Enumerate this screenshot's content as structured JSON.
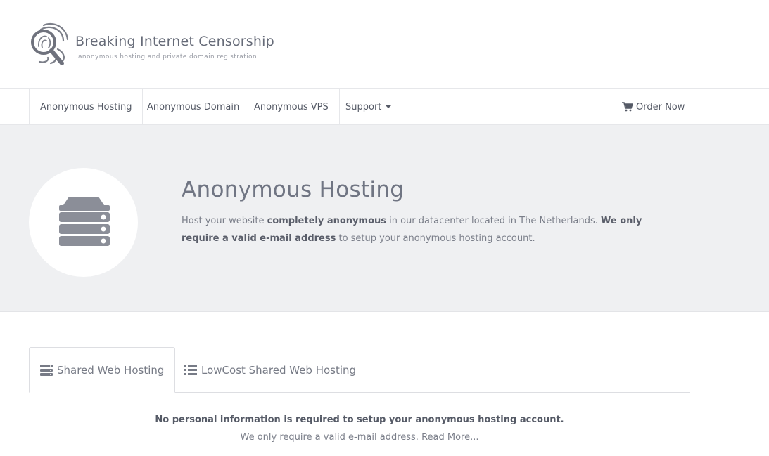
{
  "brand": {
    "title": "Breaking Internet Censorship",
    "subtitle": "anonymous hosting and private domain registration",
    "logo_icon": "fingerprint-magnifier-icon"
  },
  "nav": {
    "items": [
      {
        "label": "Anonymous Hosting"
      },
      {
        "label": "Anonymous Domain"
      },
      {
        "label": "Anonymous VPS"
      },
      {
        "label": "Support"
      }
    ],
    "order_label": "Order Now",
    "order_icon": "cart-icon"
  },
  "hero": {
    "icon": "server-icon",
    "title": "Anonymous Hosting",
    "desc_part1": "Host your website ",
    "desc_bold1": "completely anonymous",
    "desc_part2": " in our datacenter located in The Netherlands. ",
    "desc_bold2": "We only require a valid e-mail address",
    "desc_part3": " to setup your anonymous hosting account."
  },
  "tabs": [
    {
      "label": "Shared Web Hosting",
      "icon": "server-stack-icon",
      "active": true
    },
    {
      "label": "LowCost Shared Web Hosting",
      "icon": "list-icon",
      "active": false
    }
  ],
  "content": {
    "line1": "No personal information is required to setup your anonymous hosting account.",
    "line2": "We only require a valid e-mail address. ",
    "read_more": "Read More..."
  },
  "colors": {
    "hero_bg": "#eff0f2",
    "text": "#555a66",
    "icon": "#8b8e98"
  }
}
